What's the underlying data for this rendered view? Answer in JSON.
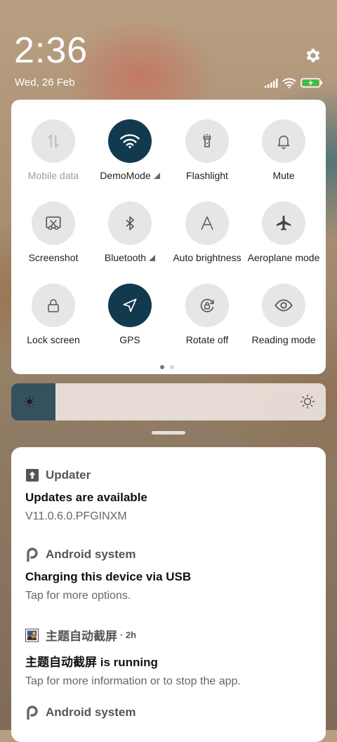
{
  "status_bar": {
    "time": "2:36",
    "date": "Wed, 26 Feb",
    "settings_icon": "gear-icon",
    "signal_icon": "cell-signal-icon",
    "wifi_icon": "wifi-icon",
    "battery_icon": "battery-charging-icon"
  },
  "quick_settings": {
    "tiles": [
      {
        "label": "Mobile data",
        "icon": "mobile-data-icon",
        "state": "disabled"
      },
      {
        "label": "DemoMode",
        "icon": "wifi-icon",
        "state": "on",
        "has_menu": true
      },
      {
        "label": "Flashlight",
        "icon": "flashlight-icon",
        "state": "off"
      },
      {
        "label": "Mute",
        "icon": "bell-icon",
        "state": "off"
      },
      {
        "label": "Screenshot",
        "icon": "screenshot-icon",
        "state": "off"
      },
      {
        "label": "Bluetooth",
        "icon": "bluetooth-icon",
        "state": "off",
        "has_menu": true
      },
      {
        "label": "Auto brightness",
        "icon": "auto-brightness-icon",
        "state": "off"
      },
      {
        "label": "Aeroplane mode",
        "icon": "airplane-icon",
        "state": "off"
      },
      {
        "label": "Lock screen",
        "icon": "lock-icon",
        "state": "off"
      },
      {
        "label": "GPS",
        "icon": "location-arrow-icon",
        "state": "on"
      },
      {
        "label": "Rotate off",
        "icon": "rotate-lock-icon",
        "state": "off"
      },
      {
        "label": "Reading mode",
        "icon": "eye-icon",
        "state": "off"
      }
    ],
    "page_count": 2,
    "current_page": 1,
    "active_color": "#113a4f"
  },
  "brightness": {
    "level": 0.14,
    "low_icon": "sun-small-icon",
    "high_icon": "sun-large-icon"
  },
  "notifications": [
    {
      "app": "Updater",
      "icon": "arrow-up-box-icon",
      "title": "Updates are available",
      "text": "V11.0.6.0.PFGINXM",
      "time": ""
    },
    {
      "app": "Android system",
      "icon": "android-p-icon",
      "title": "Charging this device via USB",
      "text": "Tap for more options.",
      "time": ""
    },
    {
      "app": "主题自动截屏",
      "icon": "app-thumbnail-icon",
      "title": "主题自动截屏 is running",
      "text": "Tap for more information or to stop the app.",
      "time": "2h"
    },
    {
      "app": "Android system",
      "icon": "android-p-icon",
      "title": "",
      "text": "",
      "time": ""
    }
  ]
}
